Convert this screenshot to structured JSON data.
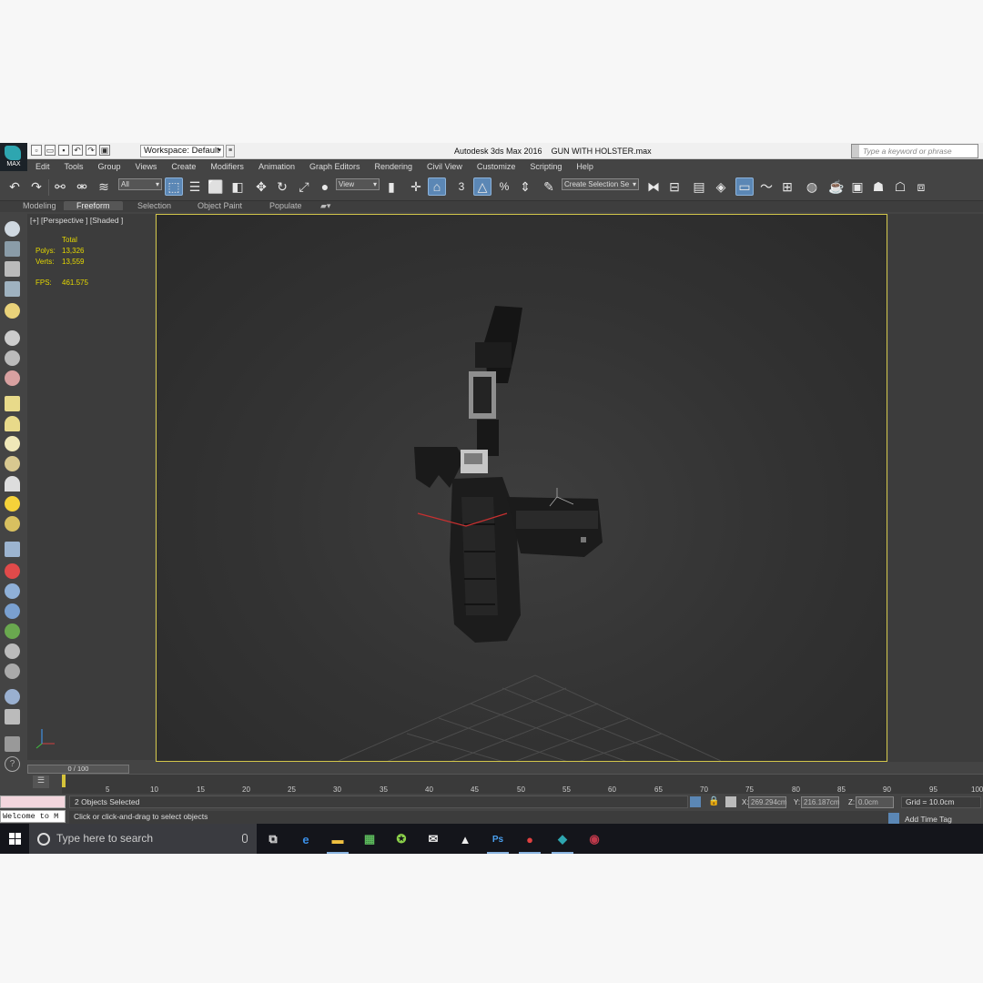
{
  "app": {
    "logo_text": "MAX",
    "title": "Autodesk 3ds Max 2016",
    "filename": "GUN WITH HOLSTER.max",
    "workspace": "Workspace: Default",
    "search_placeholder": "Type a keyword or phrase"
  },
  "menu": [
    "Edit",
    "Tools",
    "Group",
    "Views",
    "Create",
    "Modifiers",
    "Animation",
    "Graph Editors",
    "Rendering",
    "Civil View",
    "Customize",
    "Scripting",
    "Help"
  ],
  "toolbar": {
    "filter_value": "All",
    "refcoord_value": "View",
    "selection_set": "Create Selection Se",
    "snap_label": "3",
    "percent_label": "%"
  },
  "ribbon": {
    "tabs": [
      "Modeling",
      "Freeform",
      "Selection",
      "Object Paint",
      "Populate"
    ],
    "active": "Freeform"
  },
  "viewport": {
    "label": "[+] [Perspective ] [Shaded ]",
    "stats_header": "Total",
    "polys_label": "Polys:",
    "polys_value": "13,326",
    "verts_label": "Verts:",
    "verts_value": "13,559",
    "fps_label": "FPS:",
    "fps_value": "461.575",
    "border_color": "#d2c64a",
    "stats_color": "#e5d800"
  },
  "timeline": {
    "frame_display": "0 / 100",
    "ticks": [
      "5",
      "10",
      "15",
      "20",
      "25",
      "30",
      "35",
      "40",
      "45",
      "50",
      "55",
      "60",
      "65",
      "70",
      "75",
      "80",
      "85",
      "90",
      "95",
      "100"
    ]
  },
  "status": {
    "console_text": "Welcome to M",
    "selected": "2 Objects Selected",
    "prompt": "Click or click-and-drag to select objects",
    "x_label": "X:",
    "x_value": "269.294cm",
    "y_label": "Y:",
    "y_value": "216.187cm",
    "z_label": "Z:",
    "z_value": "0.0cm",
    "grid": "Grid = 10.0cm",
    "time_tag": "Add Time Tag"
  },
  "taskbar": {
    "search_text": "Type here to search",
    "apps": [
      "task-view",
      "edge",
      "file-explorer",
      "tool",
      "xbox",
      "mail",
      "photos",
      "photoshop",
      "scribd",
      "3dsmax",
      "obs"
    ]
  }
}
